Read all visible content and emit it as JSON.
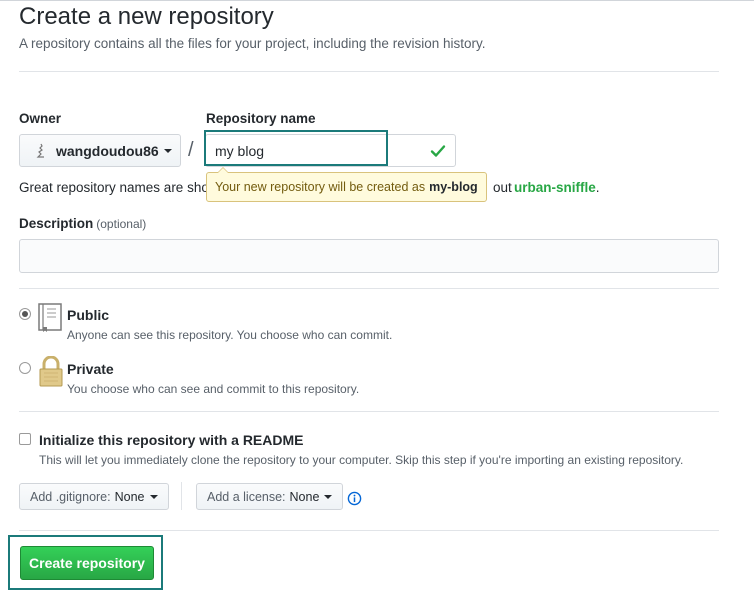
{
  "page": {
    "title": "Create a new repository",
    "subtitle": "A repository contains all the files for your project, including the revision history."
  },
  "owner": {
    "label": "Owner",
    "name": "wangdoudou86",
    "avatar_icon": "user-avatar-icon"
  },
  "separator": "/",
  "repo": {
    "label": "Repository name",
    "value": "my blog",
    "valid_icon": "check-icon",
    "valid_color": "#28a745"
  },
  "hint": {
    "text_visible": "Great repository names are sho",
    "text_tail": "out",
    "suggestion": "urban-sniffle",
    "suffix": "."
  },
  "tooltip": {
    "text": "Your new repository will be created as",
    "slug": "my-blog"
  },
  "description": {
    "label": "Description",
    "optional": "(optional)",
    "value": ""
  },
  "visibility": {
    "selected": "public",
    "public": {
      "title": "Public",
      "desc": "Anyone can see this repository. You choose who can commit.",
      "icon": "book-icon"
    },
    "private": {
      "title": "Private",
      "desc": "You choose who can see and commit to this repository.",
      "icon": "lock-icon"
    }
  },
  "readme": {
    "checked": false,
    "title": "Initialize this repository with a README",
    "desc": "This will let you immediately clone the repository to your computer. Skip this step if you're importing an existing repository."
  },
  "gitignore": {
    "label": "Add .gitignore:",
    "value": "None"
  },
  "license": {
    "label": "Add a license:",
    "value": "None",
    "info_icon": "info-icon"
  },
  "submit": {
    "label": "Create repository",
    "color": "#28a745"
  },
  "colors": {
    "highlight": "#1b7a7a",
    "tooltip_bg": "#fffbdd"
  }
}
